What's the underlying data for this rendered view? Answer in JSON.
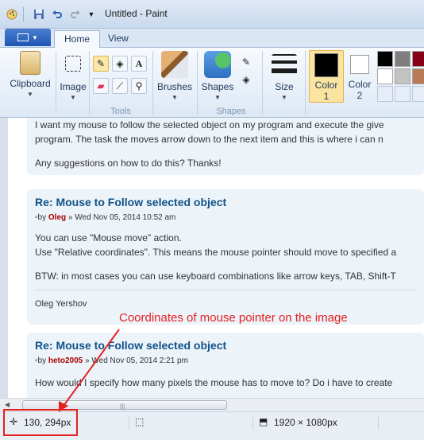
{
  "window": {
    "title": "Untitled - Paint"
  },
  "ribbon": {
    "tabs": [
      {
        "label": "Home",
        "active": true
      },
      {
        "label": "View",
        "active": false
      }
    ],
    "groups": {
      "clipboard": {
        "label": "Clipboard"
      },
      "image": {
        "label": "Image"
      },
      "tools": {
        "label": "Tools"
      },
      "brushes": {
        "label": "Brushes"
      },
      "shapes": {
        "label": "Shapes",
        "group_label": "Shapes"
      },
      "size": {
        "label": "Size"
      },
      "color1": {
        "label": "Color",
        "num": "1",
        "color": "#000000"
      },
      "color2": {
        "label": "Color",
        "num": "2",
        "color": "#ffffff"
      }
    },
    "palette": [
      "#000000",
      "#7f7f7f",
      "#880015",
      "#ffffff",
      "#c3c3c3",
      "#b97a57"
    ]
  },
  "document": {
    "intro_line1": "I want my mouse to follow the selected object on my program and execute the give",
    "intro_line2": "program. The task the moves arrow down to the next item and this is where i can n",
    "intro_line3": "Any suggestions on how to do this? Thanks!",
    "posts": [
      {
        "title": "Re: Mouse to Follow selected object",
        "by": "by",
        "author": "Oleg",
        "date": "» Wed Nov 05, 2014 10:52 am",
        "lines": [
          "You can use \"Mouse move\" action.",
          "Use \"Relative coordinates\". This means the mouse pointer should move to specified a",
          "BTW: in most cases you can use keyboard combinations like arrow keys, TAB, Shift-T"
        ],
        "signature": "Oleg Yershov"
      },
      {
        "title": "Re: Mouse to Follow selected object",
        "by": "by",
        "author": "heto2005",
        "date": "» Wed Nov 05, 2014 2:21 pm",
        "lines": [
          "How would I specify how many pixels the mouse has to move to? Do i have to create"
        ]
      }
    ]
  },
  "statusbar": {
    "pointer_coords": "130, 294px",
    "image_size": "1920 × 1080px"
  },
  "annotation": {
    "text": "Coordinates of mouse pointer on the image"
  }
}
